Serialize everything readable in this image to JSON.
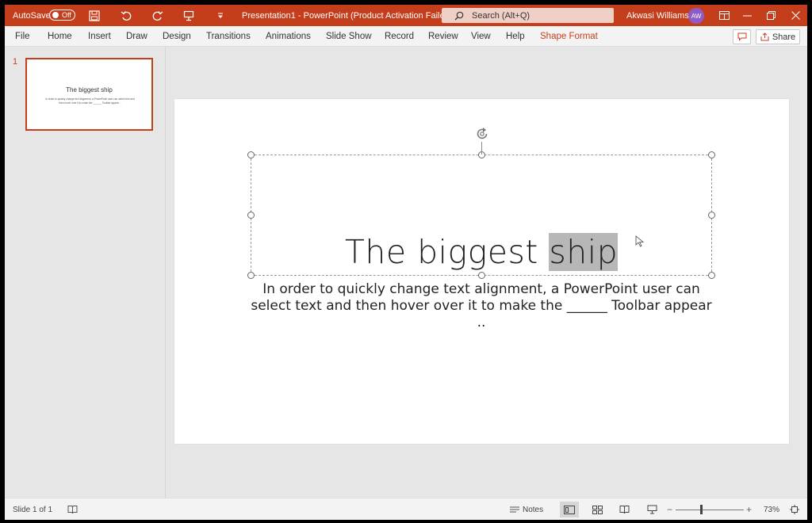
{
  "titlebar": {
    "autosave_label": "AutoSave",
    "autosave_state": "Off",
    "document_title": "Presentation1  -  PowerPoint (Product Activation Failed)",
    "search_placeholder": "Search (Alt+Q)",
    "user_name": "Akwasi Williams",
    "user_initials": "AW",
    "accent_color": "#c43e1c"
  },
  "ribbon_tabs": [
    "File",
    "Home",
    "Insert",
    "Draw",
    "Design",
    "Transitions",
    "Animations",
    "Slide Show",
    "Record",
    "Review",
    "View",
    "Help",
    "Shape Format"
  ],
  "share_label": "Share",
  "thumbnails": [
    {
      "number": "1",
      "title": "The biggest ship",
      "body": "In order to quickly change text alignment, a PowerPoint user can select text and then hover over it to make the ______ Toolbar appear .."
    }
  ],
  "slide": {
    "title_plain": "The biggest ",
    "title_selected": "ship",
    "body": "In order to quickly change text alignment, a PowerPoint user can select text and then hover over it to make the ______ Toolbar appear .."
  },
  "statusbar": {
    "slide_info": "Slide 1 of 1",
    "notes_label": "Notes",
    "zoom_level": "73%"
  }
}
